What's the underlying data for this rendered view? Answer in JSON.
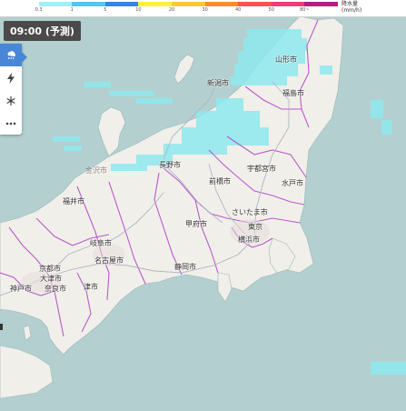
{
  "legend": {
    "ticks": [
      "0.3",
      "1",
      "5",
      "10",
      "20",
      "30",
      "40",
      "50",
      "80~"
    ],
    "unit_line1": "降水量",
    "unit_line2": "(mm/h)",
    "colors": [
      "#ffffff",
      "#a0f0f5",
      "#50c8f0",
      "#3284e6",
      "#fff03c",
      "#ffc832",
      "#ff8c28",
      "#ff5050",
      "#f03c78",
      "#b41e82"
    ]
  },
  "time_badge": "09:00 (予測)",
  "toolbar": {
    "items": [
      {
        "icon": "rain-cloud-icon",
        "active": true
      },
      {
        "icon": "lightning-icon",
        "active": false
      },
      {
        "icon": "snow-icon",
        "active": false
      },
      {
        "icon": "more-icon",
        "active": false
      }
    ]
  },
  "cities": {
    "yamagata": "山形市",
    "niigata": "新潟市",
    "fukushima": "福島市",
    "nagano": "長野市",
    "utsunomiya": "宇都宮市",
    "maebashi": "前橋市",
    "mito": "水戸市",
    "fukui": "福井市",
    "saitama": "さいたま市",
    "kofu": "甲府市",
    "tokyo": "東京",
    "yokohama": "横浜市",
    "gifu": "岐阜市",
    "nagoya": "名古屋市",
    "shizuoka": "静岡市",
    "kyoto": "京都市",
    "otsu": "大津市",
    "kobe": "神戸市",
    "nara": "奈良市",
    "tsu": "津市",
    "kanazawa": "金沢市"
  },
  "colors": {
    "sea": "#b3cfcf",
    "land": "#f1efe9",
    "rain_light": "#8ee9ef",
    "boundary": "#b040c8"
  }
}
